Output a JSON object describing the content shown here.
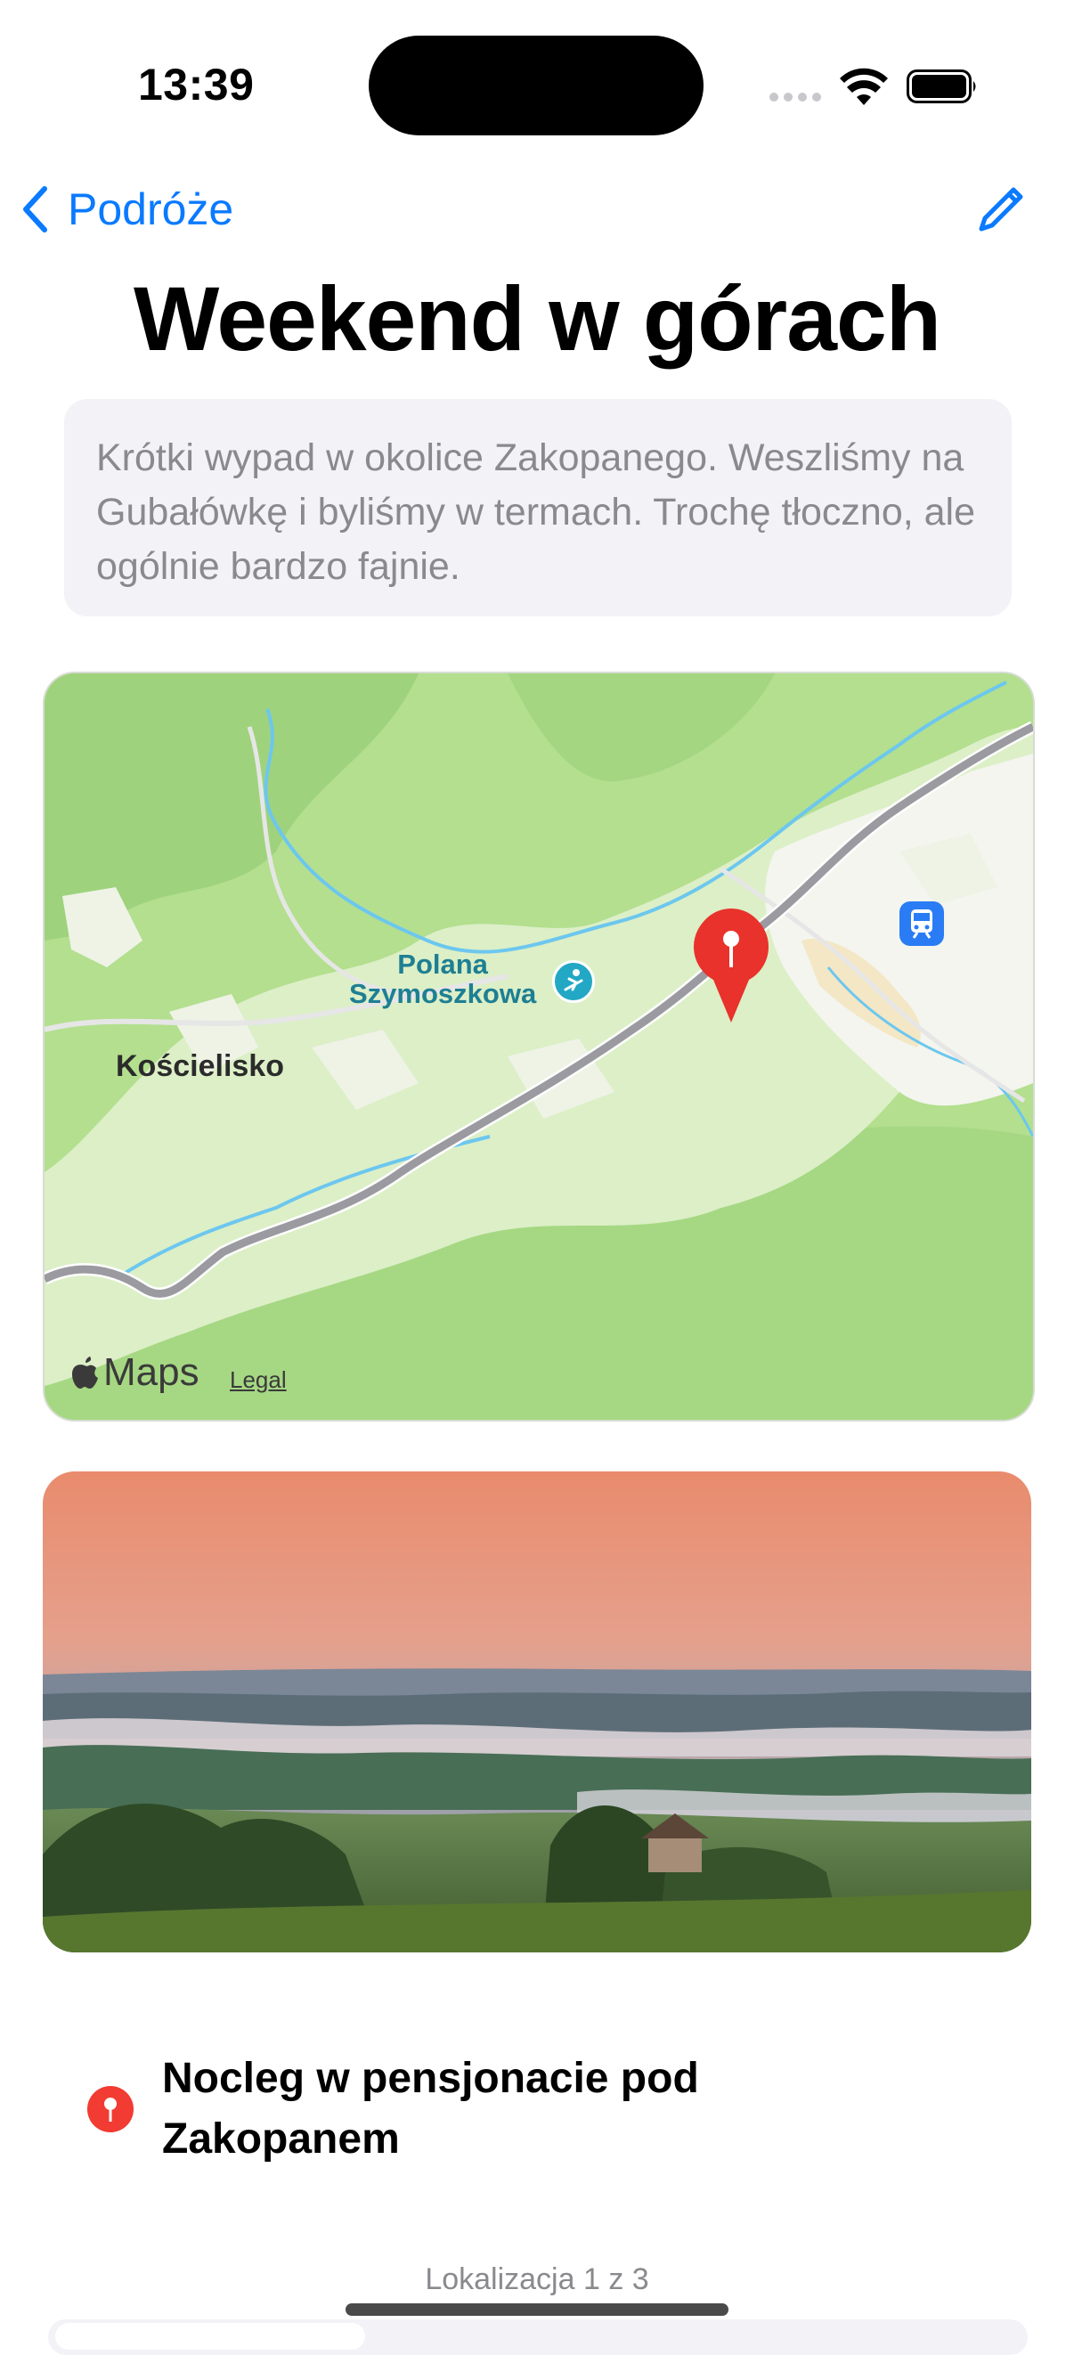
{
  "status_bar": {
    "time": "13:39"
  },
  "nav": {
    "back_label": "Podróże",
    "edit_icon": "pencil-icon"
  },
  "title": "Weekend w górach",
  "notes": "Krótki wypad w okolice Zakopanego. Weszliśmy na Gubałówkę i byliśmy w termach. Trochę tłoczno, ale ogólnie bardzo fajnie.",
  "map": {
    "town_label": "Kościelisko",
    "poi_label_line1": "Polana",
    "poi_label_line2": "Szymoszkowa",
    "brand": "Maps",
    "legal": "Legal",
    "icons": [
      "ski-icon",
      "train-icon",
      "map-pin-icon"
    ],
    "colors": {
      "forest": "#a9d98a",
      "road": "#9a9aa0",
      "river": "#5fc3ee",
      "pin": "#e8322b"
    }
  },
  "photo": {
    "description_icon": "landscape-photo"
  },
  "location": {
    "label": "Nocleg w pensjonacie pod Zakopanem",
    "icon": "pin-icon",
    "color": "#f23b32"
  },
  "pager": {
    "text": "Lokalizacja 1 z 3"
  }
}
